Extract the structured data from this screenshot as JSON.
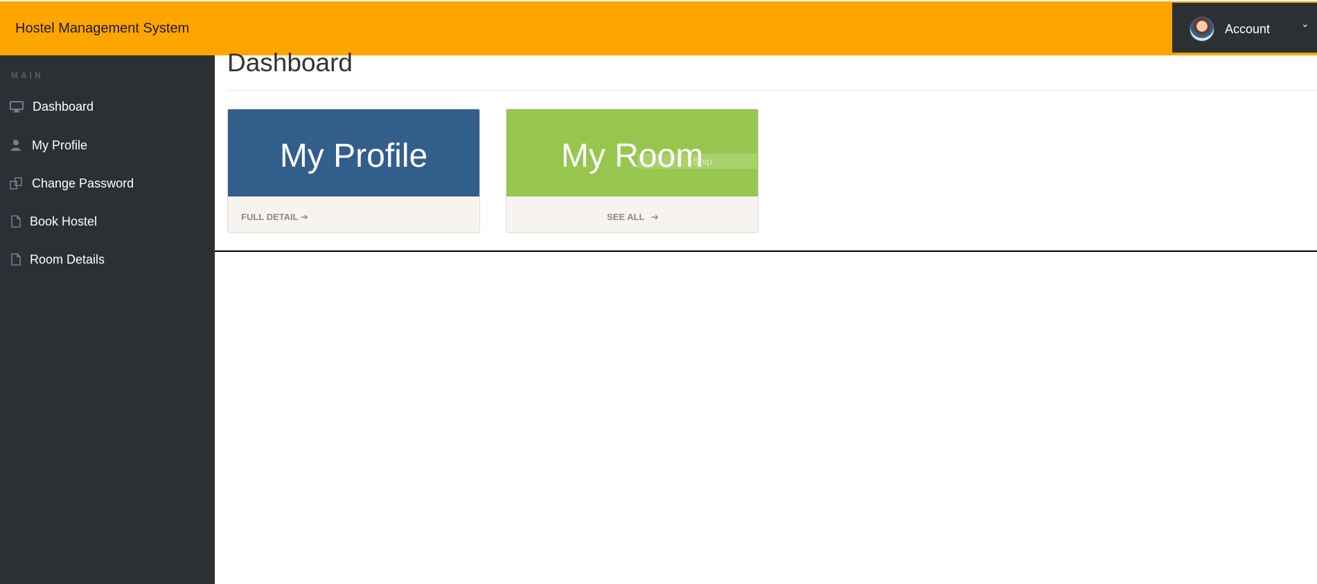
{
  "header": {
    "brand": "Hostel Management System",
    "account_label": "Account",
    "caret": "⌄"
  },
  "sidebar": {
    "heading": "MAIN",
    "items": [
      {
        "label": "Dashboard",
        "icon": "desktop-icon"
      },
      {
        "label": "My Profile",
        "icon": "user-icon"
      },
      {
        "label": "Change Password",
        "icon": "copy-icon"
      },
      {
        "label": "Book Hostel",
        "icon": "file-icon"
      },
      {
        "label": "Room Details",
        "icon": "file-icon"
      }
    ]
  },
  "main": {
    "title": "Dashboard",
    "cards": [
      {
        "title": "My Profile",
        "link": "FULL DETAIL",
        "arrow": "➔",
        "color": "#325e8c"
      },
      {
        "title": "My Room",
        "link": "SEE ALL",
        "arrow": "➔",
        "color": "#96c64d"
      }
    ],
    "snip_overlay": "Snip"
  },
  "colors": {
    "topbar": "#ffa500",
    "sidebar": "#2b3034"
  }
}
